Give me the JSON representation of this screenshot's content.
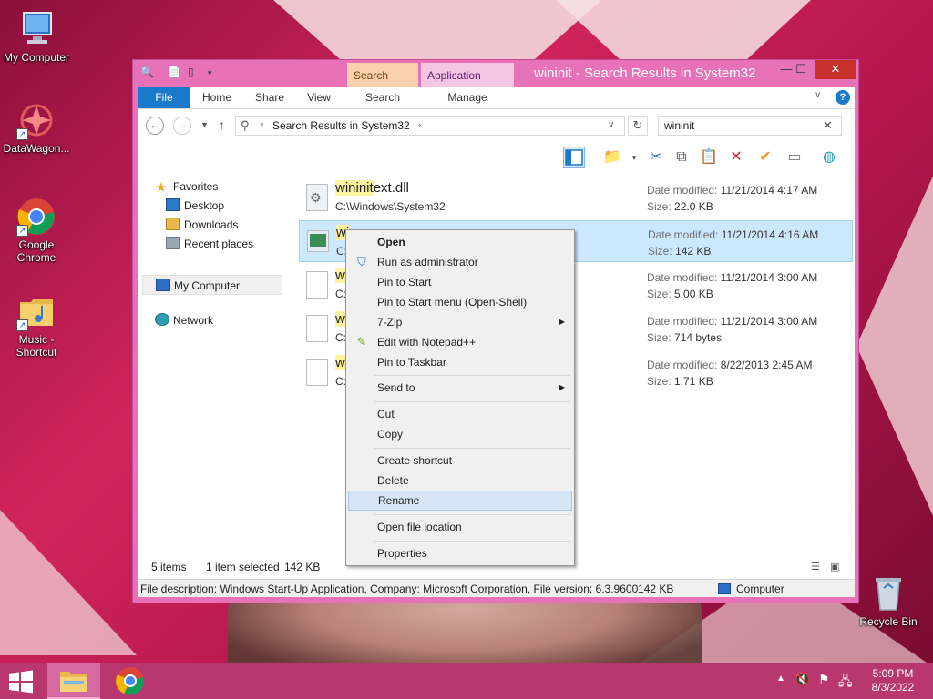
{
  "desktop": {
    "icons": [
      {
        "label": "My Computer",
        "icon": "computer-icon"
      },
      {
        "label": "DataWagon...",
        "icon": "datawagon-icon"
      },
      {
        "label": "Google Chrome",
        "icon": "chrome-icon"
      },
      {
        "label": "Music - Shortcut",
        "icon": "music-folder-icon"
      },
      {
        "label": "Recycle Bin",
        "icon": "recycle-bin-icon"
      }
    ]
  },
  "window": {
    "title": "wininit - Search Results in System32",
    "context_tabs": {
      "search_tools": "Search Tools",
      "application_tools": "Application Tools"
    },
    "ribbon": {
      "file": "File",
      "home": "Home",
      "share": "Share",
      "view": "View",
      "search": "Search",
      "manage": "Manage"
    },
    "address": {
      "path": "Search Results in System32"
    },
    "search": {
      "value": "wininit"
    },
    "nav": {
      "favorites": "Favorites",
      "desktop": "Desktop",
      "downloads": "Downloads",
      "recent": "Recent places",
      "my_computer": "My Computer",
      "network": "Network"
    },
    "files": [
      {
        "match": "wininit",
        "rest": "ext.dll",
        "path": "C:\\Windows\\System32",
        "modified_label": "Date modified:",
        "modified": "11/21/2014 4:17 AM",
        "size_label": "Size:",
        "size": "22.0 KB"
      },
      {
        "match": "wi",
        "rest": "",
        "path": "C:",
        "modified_label": "Date modified:",
        "modified": "11/21/2014 4:16 AM",
        "size_label": "Size:",
        "size": "142 KB"
      },
      {
        "match": "wi",
        "rest": "",
        "path": "C:",
        "modified_label": "Date modified:",
        "modified": "11/21/2014 3:00 AM",
        "size_label": "Size:",
        "size": "5.00 KB"
      },
      {
        "match": "wi",
        "rest": "",
        "path": "C:",
        "modified_label": "Date modified:",
        "modified": "11/21/2014 3:00 AM",
        "size_label": "Size:",
        "size": "714 bytes"
      },
      {
        "match": "wi",
        "rest": "",
        "path": "C:",
        "modified_label": "Date modified:",
        "modified": "8/22/2013 2:45 AM",
        "size_label": "Size:",
        "size": "1.71 KB"
      }
    ],
    "status": {
      "items": "5 items",
      "selected": "1 item selected",
      "selected_size": "142 KB"
    },
    "details": {
      "description": "File description: Windows Start-Up Application, Company: Microsoft Corporation, File version: 6.3.9600",
      "size": "142 KB",
      "location": "Computer"
    }
  },
  "context_menu": {
    "open": "Open",
    "run_as_admin": "Run as administrator",
    "pin_to_start": "Pin to Start",
    "pin_to_start_menu": "Pin to Start menu (Open-Shell)",
    "seven_zip": "7-Zip",
    "edit_notepadpp": "Edit with Notepad++",
    "pin_to_taskbar": "Pin to Taskbar",
    "send_to": "Send to",
    "cut": "Cut",
    "copy": "Copy",
    "create_shortcut": "Create shortcut",
    "delete": "Delete",
    "rename": "Rename",
    "open_file_location": "Open file location",
    "properties": "Properties"
  },
  "taskbar": {
    "time": "5:09 PM",
    "date": "8/3/2022"
  },
  "colors": {
    "window_frame": "#e872b8",
    "ribbon_file_tab": "#1979ca",
    "selection": "#cce8ff",
    "menu_hover": "#d5e5f5",
    "taskbar": "#b8376f",
    "close_button": "#c8302b"
  }
}
